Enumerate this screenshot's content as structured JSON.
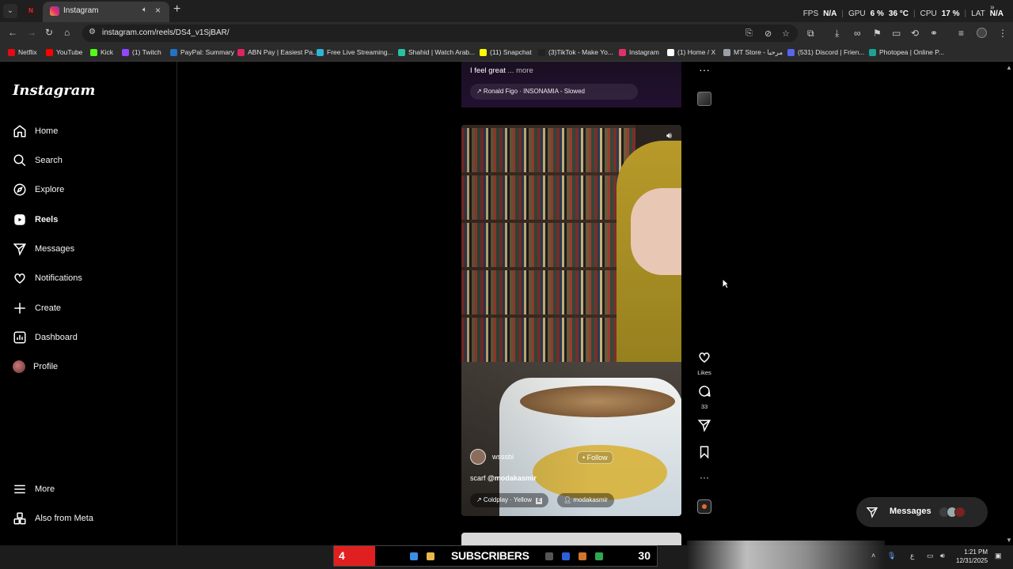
{
  "browser": {
    "tab_title": "Instagram",
    "url": "instagram.com/reels/DS4_v1SjBAR/",
    "perf": {
      "fps_label": "FPS",
      "fps_value": "N/A",
      "gpu_label": "GPU",
      "gpu_value": "6 %",
      "gpu_temp": "36 °C",
      "cpu_label": "CPU",
      "cpu_value": "17 %",
      "lat_label": "LAT",
      "lat_value": "N/A"
    },
    "bookmarks": [
      {
        "label": "Netflix",
        "color": "#e50914"
      },
      {
        "label": "YouTube",
        "color": "#ff0000"
      },
      {
        "label": "Kick",
        "color": "#53fc18"
      },
      {
        "label": "(1) Twitch",
        "color": "#9146ff"
      },
      {
        "label": "PayPal: Summary",
        "color": "#1f74c5"
      },
      {
        "label": "ABN Pay | Easiest Pa...",
        "color": "#e0245e"
      },
      {
        "label": "Free Live Streaming...",
        "color": "#2fb5d6"
      },
      {
        "label": "Shahid | Watch Arab...",
        "color": "#27c2a0"
      },
      {
        "label": "(11) Snapchat",
        "color": "#fffc00"
      },
      {
        "label": "(3)TikTok - Make Yo...",
        "color": "#222222"
      },
      {
        "label": "Instagram",
        "color": "#e1306c"
      },
      {
        "label": "(1) Home / X",
        "color": "#ffffff"
      },
      {
        "label": "MT Store - مرحبا",
        "color": "#9aa0a6"
      },
      {
        "label": "(531) Discord | Frien...",
        "color": "#5865f2"
      },
      {
        "label": "Photopea | Online P...",
        "color": "#18a497"
      }
    ]
  },
  "sidebar": {
    "logo": "Instagram",
    "items": [
      {
        "label": "Home"
      },
      {
        "label": "Search"
      },
      {
        "label": "Explore"
      },
      {
        "label": "Reels"
      },
      {
        "label": "Messages"
      },
      {
        "label": "Notifications"
      },
      {
        "label": "Create"
      },
      {
        "label": "Dashboard"
      },
      {
        "label": "Profile"
      }
    ],
    "more": "More",
    "also_from_meta": "Also from Meta"
  },
  "prev_reel": {
    "caption": "I feel great",
    "more": "... more",
    "music": "↗ Ronald Figo · INSONAMIA - Slowed"
  },
  "reel": {
    "username": "wsssbi",
    "follow": "• Follow",
    "caption_prefix": "scarf",
    "caption_mention": "@modakasmir",
    "music": "↗ Coldplay · Yellow",
    "tagged_user": "modakasmir",
    "actions": {
      "likes_label": "Likes",
      "comments_count": "33"
    }
  },
  "messages_float": {
    "label": "Messages"
  },
  "taskbar": {
    "overlay_left": "4",
    "overlay_title": "SUBSCRIBERS",
    "overlay_count": "30",
    "time": "1:21 PM",
    "date": "12/31/2025"
  }
}
